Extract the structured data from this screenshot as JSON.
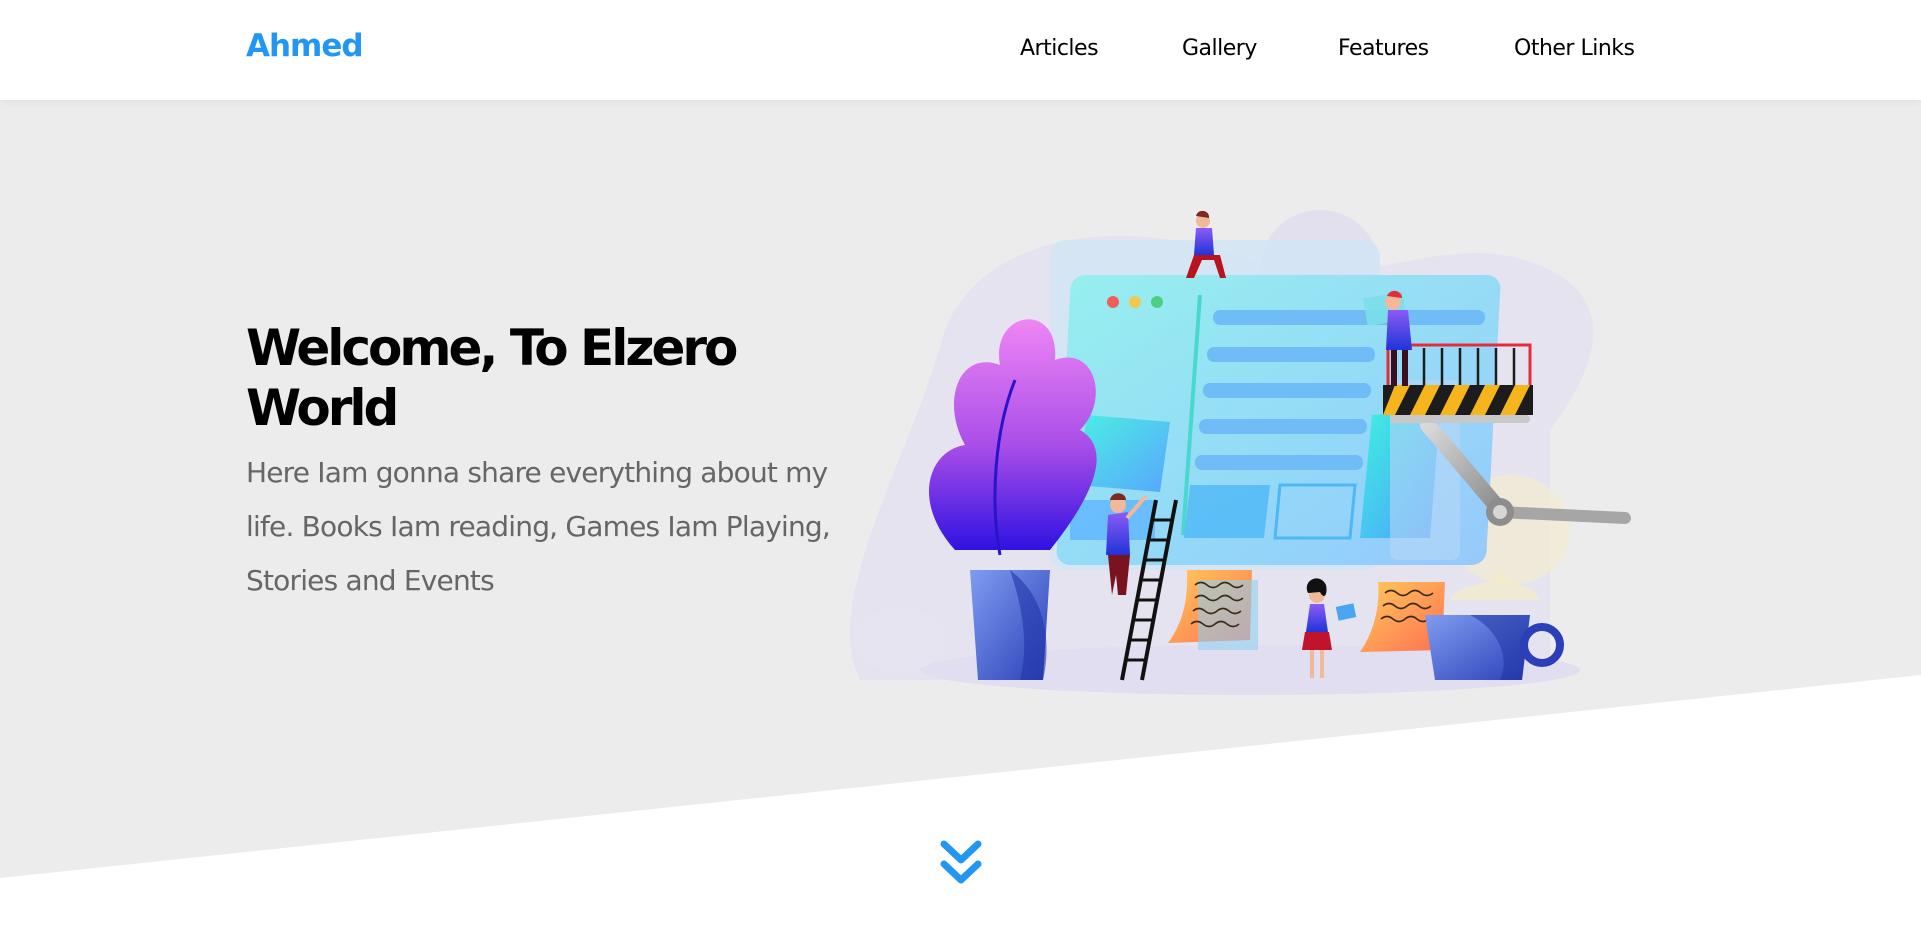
{
  "header": {
    "logo": "Ahmed",
    "nav": [
      {
        "label": "Articles"
      },
      {
        "label": "Gallery"
      },
      {
        "label": "Features"
      },
      {
        "label": "Other Links"
      }
    ]
  },
  "landing": {
    "title": "Welcome, To Elzero World",
    "description": "Here Iam gonna share everything about my life. Books Iam reading, Games Iam Playing, Stories and Events",
    "illustration_icon": "team-building-website-illustration",
    "scroll_icon": "double-chevron-down-icon"
  },
  "colors": {
    "accent": "#2196f3",
    "landing_bg": "#ececec",
    "text_dark": "#000000",
    "text_muted": "#666666"
  }
}
